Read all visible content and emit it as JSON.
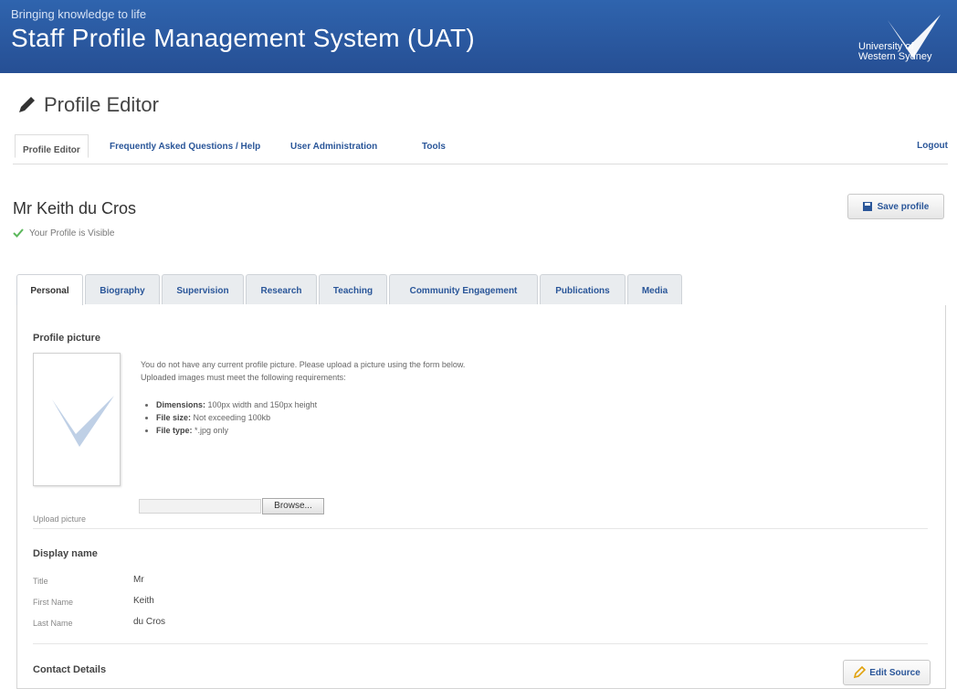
{
  "banner": {
    "tagline": "Bringing knowledge to life",
    "title": "Staff Profile Management System (UAT)",
    "logo_line1": "University of",
    "logo_line2": "Western Sydney"
  },
  "editor": {
    "title": "Profile Editor",
    "icon": "pencil-icon"
  },
  "topnav": {
    "items": [
      "Profile Editor",
      "Frequently Asked Questions / Help",
      "User Administration",
      "Tools"
    ],
    "active": "Profile Editor",
    "logout": "Logout"
  },
  "profile": {
    "name": "Mr Keith du Cros",
    "visibility": "Your Profile is Visible",
    "save_label": "Save profile"
  },
  "tabs": {
    "items": [
      "Personal",
      "Biography",
      "Supervision",
      "Research",
      "Teaching",
      "Community Engagement",
      "Publications",
      "Media"
    ],
    "active": "Personal"
  },
  "picture": {
    "heading": "Profile picture",
    "message1": "You do not have any current profile picture. Please upload a picture using the form below.",
    "message2": "Uploaded images must meet the following requirements:",
    "req1_label": "Dimensions:",
    "req1_value": "100px width and 150px height",
    "req2_label": "File size:",
    "req2_value": "Not exceeding 100kb",
    "req3_label": "File type:",
    "req3_value": "*.jpg only",
    "upload_label": "Upload picture",
    "browse_label": "Browse..."
  },
  "display_name": {
    "heading": "Display name",
    "title_label": "Title",
    "title_value": "Mr",
    "first_label": "First Name",
    "first_value": "Keith",
    "last_label": "Last Name",
    "last_value": "du Cros"
  },
  "contact": {
    "heading": "Contact Details",
    "edit_source_label": "Edit Source"
  },
  "colors": {
    "banner": "#2c5fa8",
    "link": "#2a5699",
    "check": "#5cb85c"
  }
}
